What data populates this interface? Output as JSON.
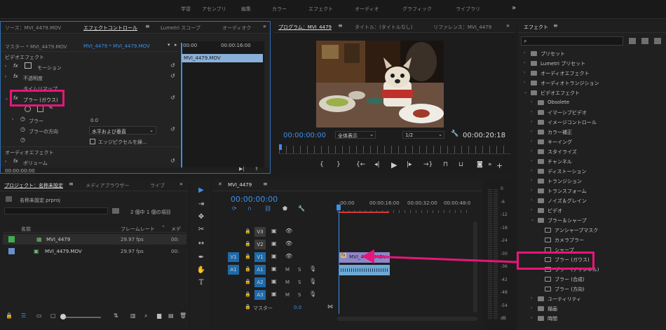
{
  "topbar": {
    "workspaces": [
      "学習",
      "アセンブリ",
      "編集",
      "カラー",
      "エフェクト",
      "オーディオ",
      "グラフィック",
      "ライブラリ"
    ],
    "more": "»"
  },
  "ec": {
    "tabs": [
      "ソース：MVI_4479.MOV",
      "エフェクトコントロール",
      "Lumetri スコープ",
      "オーディオク"
    ],
    "master": "マスター * MVI_4479.MOV",
    "sequence": "MVI_4479 * MVI_4479.MOV",
    "tl_start": "00:00",
    "tl_end": "00:00:16:00",
    "clip": "MVI_4479.MOV",
    "video_effects": "ビデオエフェクト",
    "motion": "モーション",
    "opacity": "不透明度",
    "time_remap": "タイムリマップ",
    "blur": "ブラー (ガウス)",
    "blurriness_label": "ブラー",
    "blurriness_value": "0.0",
    "blur_dir_label": "ブラーの方向",
    "blur_dir_value": "水平および垂直",
    "repeat_edge": "エッジピクセルを繰...",
    "audio_effects": "オーディオエフェクト",
    "volume": "ボリューム",
    "timecode": "00:00:00:00"
  },
  "program": {
    "tabs": [
      "プログラム：MVI_4479",
      "タイトル：(タイトルなし)",
      "リファレンス：MVI_4479"
    ],
    "timecode": "00:00:00:00",
    "fit": "全体表示",
    "resolution": "1/2",
    "duration": "00:00:20:18"
  },
  "effects": {
    "title": "エフェクト",
    "items": [
      {
        "label": "プリセット",
        "level": 0,
        "open": false,
        "icon": "star-folder"
      },
      {
        "label": "Lumetri プリセット",
        "level": 0,
        "open": false,
        "icon": "star-folder"
      },
      {
        "label": "オーディオエフェクト",
        "level": 0,
        "open": false,
        "icon": "folder"
      },
      {
        "label": "オーディオトランジション",
        "level": 0,
        "open": false,
        "icon": "folder"
      },
      {
        "label": "ビデオエフェクト",
        "level": 0,
        "open": true,
        "icon": "folder"
      },
      {
        "label": "Obsolete",
        "level": 1,
        "open": false,
        "icon": "folder"
      },
      {
        "label": "イマーシブビデオ",
        "level": 1,
        "open": false,
        "icon": "folder"
      },
      {
        "label": "イメージコントロール",
        "level": 1,
        "open": false,
        "icon": "folder"
      },
      {
        "label": "カラー補正",
        "level": 1,
        "open": false,
        "icon": "folder"
      },
      {
        "label": "キーイング",
        "level": 1,
        "open": false,
        "icon": "folder"
      },
      {
        "label": "スタイライズ",
        "level": 1,
        "open": false,
        "icon": "folder"
      },
      {
        "label": "チャンネル",
        "level": 1,
        "open": false,
        "icon": "folder"
      },
      {
        "label": "ディストーション",
        "level": 1,
        "open": false,
        "icon": "folder"
      },
      {
        "label": "トランジション",
        "level": 1,
        "open": false,
        "icon": "folder"
      },
      {
        "label": "トランスフォーム",
        "level": 1,
        "open": false,
        "icon": "folder"
      },
      {
        "label": "ノイズ＆グレイン",
        "level": 1,
        "open": false,
        "icon": "folder"
      },
      {
        "label": "ビデオ",
        "level": 1,
        "open": false,
        "icon": "folder"
      },
      {
        "label": "ブラー＆シャープ",
        "level": 1,
        "open": true,
        "icon": "folder"
      },
      {
        "label": "アンシャープマスク",
        "level": 2,
        "open": null,
        "icon": "effect"
      },
      {
        "label": "カメラブラー",
        "level": 2,
        "open": null,
        "icon": "effect"
      },
      {
        "label": "シャープ",
        "level": 2,
        "open": null,
        "icon": "effect"
      },
      {
        "label": "ブラー (ガウス)",
        "level": 2,
        "open": null,
        "icon": "effect"
      },
      {
        "label": "ブラー (チャンネル)",
        "level": 2,
        "open": null,
        "icon": "effect"
      },
      {
        "label": "ブラー (合成)",
        "level": 2,
        "open": null,
        "icon": "effect"
      },
      {
        "label": "ブラー (方向)",
        "level": 2,
        "open": null,
        "icon": "effect"
      },
      {
        "label": "ユーティリティ",
        "level": 1,
        "open": false,
        "icon": "folder"
      },
      {
        "label": "描画",
        "level": 1,
        "open": false,
        "icon": "folder"
      },
      {
        "label": "時間",
        "level": 1,
        "open": false,
        "icon": "folder"
      }
    ]
  },
  "project": {
    "tabs": [
      "プロジェクト：名称未設定",
      "メディアブラウザー",
      "ライブ"
    ],
    "file": "名称未設定.prproj",
    "selection": "2 個中 1 個の項目",
    "col_name": "名前",
    "col_rate": "フレームレート",
    "col_media": "メデ",
    "rows": [
      {
        "name": "MVI_4479",
        "rate": "29.97 fps",
        "media": "00:",
        "color": "#3fae4d"
      },
      {
        "name": "MVI_4479.MOV",
        "rate": "29.97 fps",
        "media": "00:",
        "color": "#6a8fd0"
      }
    ]
  },
  "timeline": {
    "title": "MVI_4479",
    "timecode": "00:00:00:00",
    "ruler": [
      ":00:00",
      "00:00:16:00",
      "00:00:32:00",
      "00:00:48:0"
    ],
    "tracks_video": [
      "V3",
      "V2",
      "V1"
    ],
    "tracks_audio": [
      "A1",
      "A2",
      "A3"
    ],
    "master": "マスター",
    "master_value": "0.0",
    "clip": "MVI_4479.MOV"
  },
  "meter": {
    "labels": [
      "0",
      "-6",
      "-12",
      "-18",
      "-24",
      "-30",
      "-36",
      "-42",
      "-48",
      "-54",
      "dB"
    ]
  },
  "colors": {
    "accent": "#3d8ee8",
    "highlight": "#e8157a"
  }
}
